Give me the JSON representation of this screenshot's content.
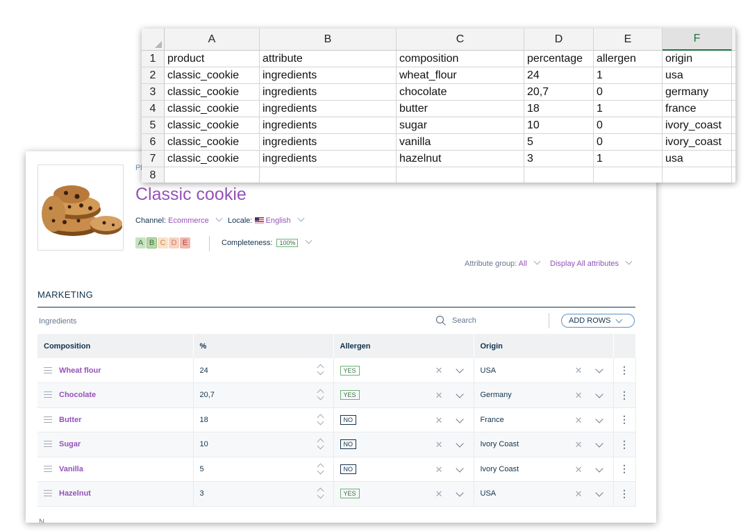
{
  "pim": {
    "breadcrumb": "Pl",
    "title": "Classic cookie",
    "channel_label": "Channel:",
    "channel_value": "Ecommerce",
    "locale_label": "Locale:",
    "locale_value": "English",
    "grades": [
      "A",
      "B",
      "C",
      "D",
      "E"
    ],
    "completeness_label": "Completeness:",
    "completeness_value": "100%",
    "attribute_group_label": "Attribute group:",
    "attribute_group_value": "All",
    "display_label": "Display All attributes",
    "section_title": "MARKETING",
    "table_label": "Ingredients",
    "search_placeholder": "Search",
    "add_rows_label": "ADD ROWS",
    "columns": [
      "Composition",
      "%",
      "Allergen",
      "Origin"
    ],
    "rows": [
      {
        "composition": "Wheat flour",
        "percent": "24",
        "allergen": "YES",
        "origin": "USA"
      },
      {
        "composition": "Chocolate",
        "percent": "20,7",
        "allergen": "YES",
        "origin": "Germany"
      },
      {
        "composition": "Butter",
        "percent": "18",
        "allergen": "NO",
        "origin": "France"
      },
      {
        "composition": "Sugar",
        "percent": "10",
        "allergen": "NO",
        "origin": "Ivory Coast"
      },
      {
        "composition": "Vanilla",
        "percent": "5",
        "allergen": "NO",
        "origin": "Ivory Coast"
      },
      {
        "composition": "Hazelnut",
        "percent": "3",
        "allergen": "YES",
        "origin": "USA"
      }
    ],
    "next_section_cutoff": "N"
  },
  "sheet": {
    "columns": [
      "A",
      "B",
      "C",
      "D",
      "E",
      "F"
    ],
    "selected_column": "F",
    "row_numbers": [
      "1",
      "2",
      "3",
      "4",
      "5",
      "6",
      "7",
      "8"
    ],
    "rows": [
      [
        "product",
        "attribute",
        "composition",
        "percentage",
        "allergen",
        "origin"
      ],
      [
        "classic_cookie",
        "ingredients",
        "wheat_flour",
        "24",
        "1",
        "usa"
      ],
      [
        "classic_cookie",
        "ingredients",
        "chocolate",
        "20,7",
        "0",
        "germany"
      ],
      [
        "classic_cookie",
        "ingredients",
        "butter",
        "18",
        "1",
        "france"
      ],
      [
        "classic_cookie",
        "ingredients",
        "sugar",
        "10",
        "0",
        "ivory_coast"
      ],
      [
        "classic_cookie",
        "ingredients",
        "vanilla",
        "5",
        "0",
        "ivory_coast"
      ],
      [
        "classic_cookie",
        "ingredients",
        "hazelnut",
        "3",
        "1",
        "usa"
      ],
      [
        "",
        "",
        "",
        "",
        "",
        ""
      ]
    ]
  },
  "colors": {
    "accent_purple": "#9452ba",
    "text_dark": "#11324d",
    "excel_green": "#1e7145",
    "grade_colors": [
      "#c8e3c1",
      "#b9d9a5",
      "#fbe1c7",
      "#f8d3c3",
      "#f1b6ad"
    ]
  }
}
